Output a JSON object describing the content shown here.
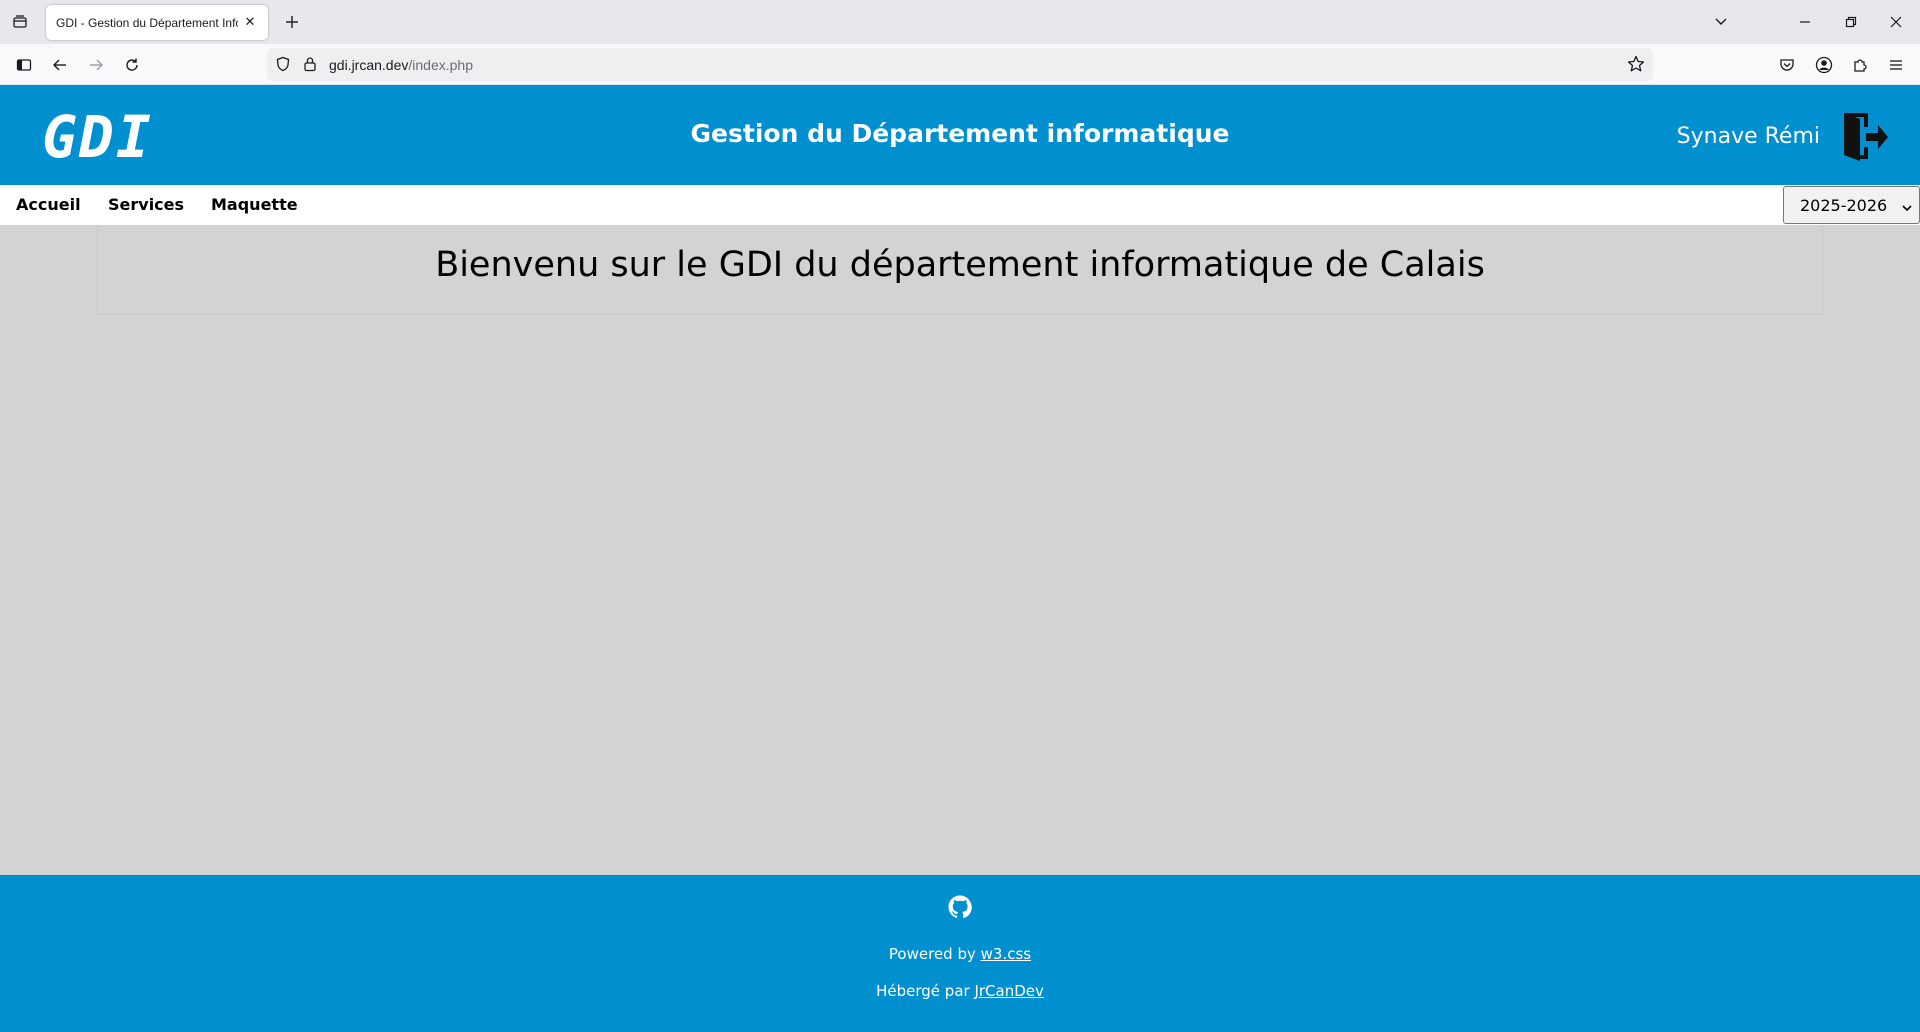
{
  "browser": {
    "tab_title": "GDI - Gestion du Département Informatique",
    "url_domain": "gdi.jrcan.dev",
    "url_path": "/index.php"
  },
  "header": {
    "logo_text": "GDI",
    "title": "Gestion du Département informatique",
    "user_name": "Synave Rémi",
    "bg_color": "#0090d0"
  },
  "menu": {
    "items": [
      "Accueil",
      "Services",
      "Maquette"
    ],
    "year_selected": "2025-2026"
  },
  "main": {
    "welcome": "Bienvenu sur le GDI du département informatique de Calais"
  },
  "footer": {
    "powered_prefix": "Powered by ",
    "powered_link": "w3.css",
    "hosted_prefix": "Hébergé par ",
    "hosted_link": "JrCanDev"
  },
  "icons": {
    "tab_list": "tab-list-icon",
    "new_tab": "plus-icon",
    "sidebar": "sidebar-icon",
    "back": "back-arrow-icon",
    "forward": "forward-arrow-icon",
    "reload": "reload-icon",
    "shield": "tracking-shield-icon",
    "lock": "lock-icon",
    "bookmark": "star-icon",
    "pocket": "pocket-icon",
    "account": "account-icon",
    "extensions": "puzzle-icon",
    "menu": "hamburger-menu-icon",
    "logout": "logout-door-icon",
    "github": "github-icon"
  }
}
